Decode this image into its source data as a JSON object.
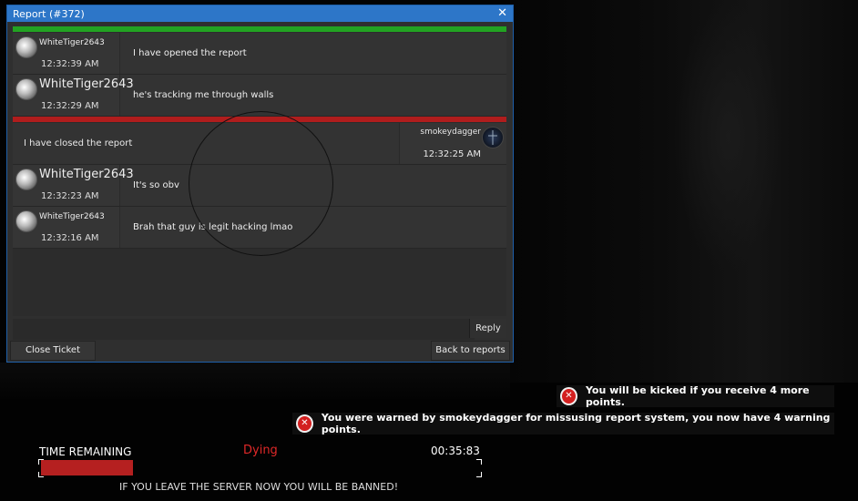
{
  "window": {
    "title": "Report (#372)",
    "close_symbol": "✕",
    "messages": [
      {
        "type": "status",
        "color": "green"
      },
      {
        "author": "WhiteTiger2643",
        "author_size": "small",
        "time": "12:32:39 AM",
        "text": "I have opened the report"
      },
      {
        "author": "WhiteTiger2643",
        "author_size": "big",
        "time": "12:32:29 AM",
        "text": "he's tracking me through walls"
      },
      {
        "type": "status",
        "color": "red"
      },
      {
        "author": "smokeydagger",
        "time": "12:32:25 AM",
        "text": "I have closed the report",
        "side": "right"
      },
      {
        "author": "WhiteTiger2643",
        "author_size": "big",
        "time": "12:32:23 AM",
        "text": "It's so obv"
      },
      {
        "author": "WhiteTiger2643",
        "author_size": "small",
        "time": "12:32:16 AM",
        "text": "Brah that guy is legit hacking lmao"
      }
    ],
    "reply_label": "Reply",
    "close_ticket_label": "Close Ticket",
    "back_label": "Back to reports"
  },
  "notifications": [
    {
      "text": "You will be kicked if you receive 4 more points."
    },
    {
      "text": "You were warned by smokeydagger for missusing report system, you now have 4 warning points."
    }
  ],
  "hud": {
    "time_remaining_label": "TIME REMAINING",
    "status": "Dying",
    "timer": "00:35:83",
    "progress_fraction": 0.21,
    "warning": "IF YOU LEAVE THE SERVER NOW YOU WILL BE BANNED!"
  },
  "colors": {
    "title_bar": "#2d76c8",
    "open_bar": "#22a322",
    "closed_bar": "#b01d1d",
    "dying": "#e02828",
    "notice_icon": "#d32020"
  }
}
